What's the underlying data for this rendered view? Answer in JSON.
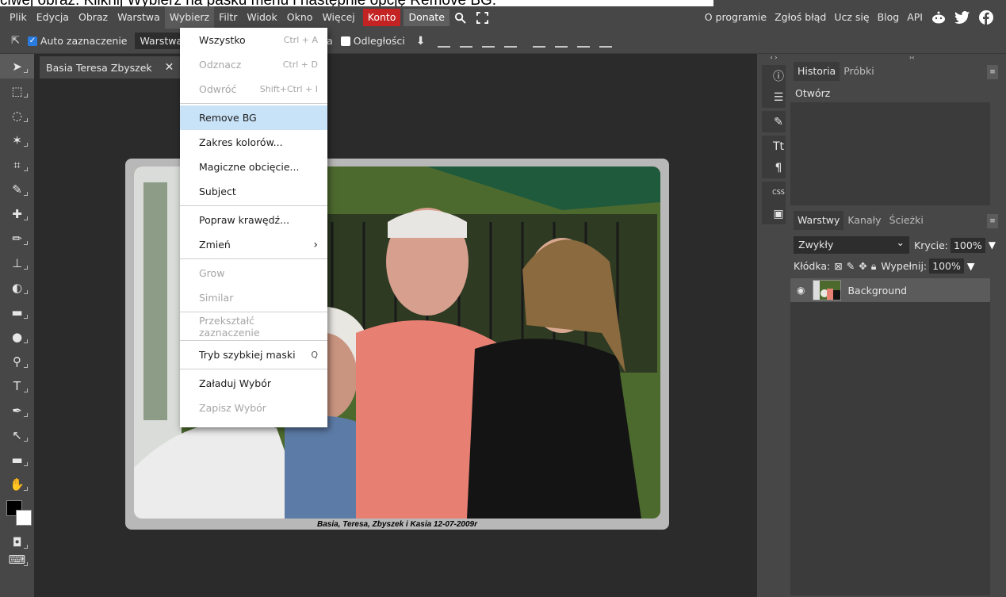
{
  "caption": "ciwej obraz. Kliknij Wybierz na pasku menu i następnie opcję Remove BG.",
  "menubar": {
    "items": [
      "Plik",
      "Edycja",
      "Obraz",
      "Warstwa",
      "Wybierz",
      "Filtr",
      "Widok",
      "Okno",
      "Więcej"
    ],
    "konto": "Konto",
    "donate": "Donate",
    "right": [
      "O programie",
      "Zgłoś błąd",
      "Ucz się",
      "Blog",
      "API"
    ]
  },
  "optbar": {
    "auto_select": "Auto zaznaczenie",
    "layer_select": "Warstwa",
    "transform_fragment": "cenia",
    "distances": "Odległości"
  },
  "document": {
    "tab_title": "Basia Teresa Zbyszek",
    "photo_caption": "Basia, Teresa, Zbyszek i Kasia 12-07-2009r"
  },
  "dropdown": {
    "items": [
      {
        "label": "Wszystko",
        "shortcut": "Ctrl + A",
        "disabled": false
      },
      {
        "label": "Odznacz",
        "shortcut": "Ctrl + D",
        "disabled": true
      },
      {
        "label": "Odwróć",
        "shortcut": "Shift+Ctrl + I",
        "disabled": true
      },
      {
        "label": "Remove BG",
        "shortcut": "",
        "disabled": false,
        "highlighted": true
      },
      {
        "label": "Zakres kolorów...",
        "shortcut": "",
        "disabled": false
      },
      {
        "label": "Magiczne obcięcie...",
        "shortcut": "",
        "disabled": false
      },
      {
        "label": "Subject",
        "shortcut": "",
        "disabled": false
      },
      {
        "label": "Popraw krawędź...",
        "shortcut": "",
        "disabled": false
      },
      {
        "label": "Zmień",
        "shortcut": "›",
        "disabled": false
      },
      {
        "label": "Grow",
        "shortcut": "",
        "disabled": true
      },
      {
        "label": "Similar",
        "shortcut": "",
        "disabled": true
      },
      {
        "label": "Przekształć zaznaczenie",
        "shortcut": "",
        "disabled": true
      },
      {
        "label": "Tryb szybkiej maski",
        "shortcut": "Q",
        "disabled": false
      },
      {
        "label": "Załaduj Wybór",
        "shortcut": "",
        "disabled": false
      },
      {
        "label": "Zapisz Wybór",
        "shortcut": "",
        "disabled": true
      }
    ]
  },
  "history_panel": {
    "tabs": [
      "Historia",
      "Próbki"
    ],
    "entries": [
      "Otwórz"
    ]
  },
  "layers_panel": {
    "tabs": [
      "Warstwy",
      "Kanały",
      "Ścieżki"
    ],
    "blend_mode": "Zwykły",
    "opacity_label": "Krycie:",
    "opacity_value": "100%",
    "lock_label": "Kłódka:",
    "fill_label": "Wypełnij:",
    "fill_value": "100%",
    "layers": [
      "Background"
    ]
  },
  "colors": {
    "konto": "#c42323",
    "highlight": "#c8e2f7",
    "checkbox": "#2a7be0"
  }
}
